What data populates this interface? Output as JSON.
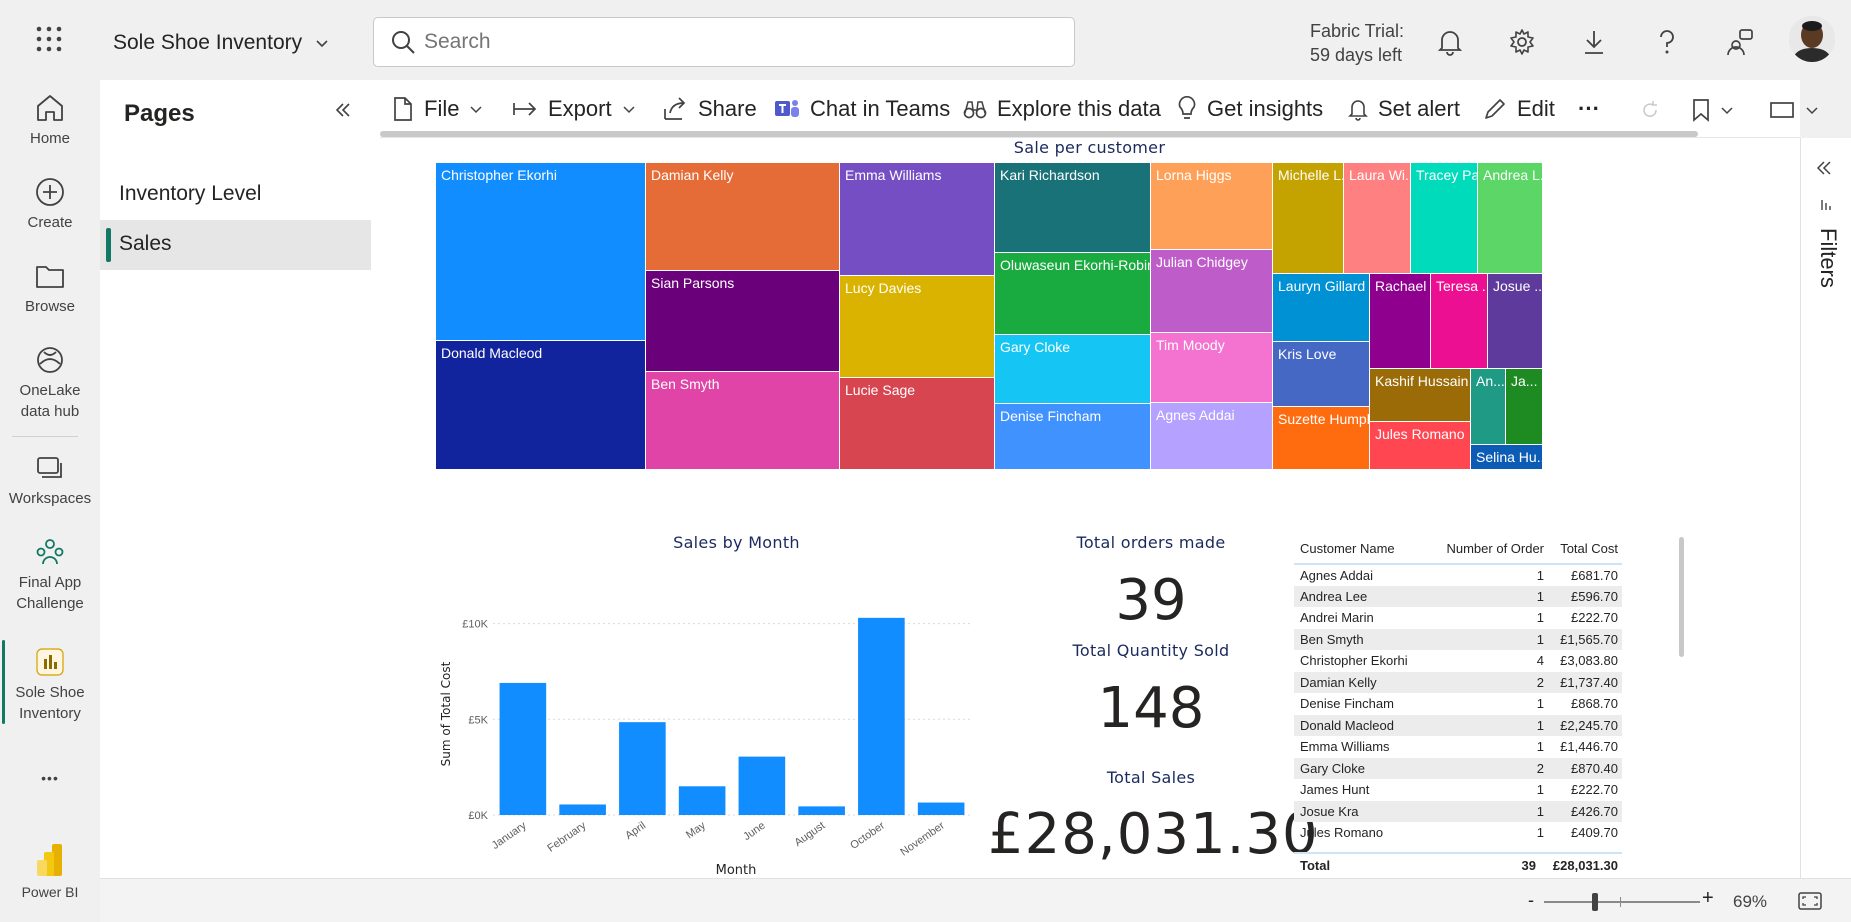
{
  "app": {
    "title": "Sole Shoe Inventory",
    "search_placeholder": "Search",
    "trial_line1": "Fabric Trial:",
    "trial_line2": "59 days left"
  },
  "nav": {
    "home": "Home",
    "create": "Create",
    "browse": "Browse",
    "onelake1": "OneLake",
    "onelake2": "data hub",
    "workspaces": "Workspaces",
    "final1": "Final App",
    "final2": "Challenge",
    "sole1": "Sole Shoe",
    "sole2": "Inventory",
    "more": "•••",
    "powerbi": "Power BI"
  },
  "pages": {
    "title": "Pages",
    "items": [
      "Inventory Level",
      "Sales"
    ],
    "selected": "Sales"
  },
  "toolbar": {
    "file": "File",
    "export": "Export",
    "share": "Share",
    "chat": "Chat in Teams",
    "explore": "Explore this data",
    "insights": "Get insights",
    "alert": "Set alert",
    "edit": "Edit",
    "more": "···"
  },
  "filters_label": "Filters",
  "treemap": {
    "title": "Sale per customer",
    "cells": [
      {
        "name": "Christopher Ekorhi",
        "color": "#118dff"
      },
      {
        "name": "Donald Macleod",
        "color": "#12239e"
      },
      {
        "name": "Damian Kelly",
        "color": "#e66c37"
      },
      {
        "name": "Sian Parsons",
        "color": "#6b007b"
      },
      {
        "name": "Ben Smyth",
        "color": "#e044a7"
      },
      {
        "name": "Emma Williams",
        "color": "#744ec2"
      },
      {
        "name": "Lucy Davies",
        "color": "#d9b300"
      },
      {
        "name": "Lucie Sage",
        "color": "#d64550"
      },
      {
        "name": "Kari Richardson",
        "color": "#197278"
      },
      {
        "name": "Oluwaseun Ekorhi-Robinson",
        "color": "#1aab40"
      },
      {
        "name": "Gary Cloke",
        "color": "#15c6f4"
      },
      {
        "name": "Denise Fincham",
        "color": "#4092ff"
      },
      {
        "name": "Lorna Higgs",
        "color": "#ffa058"
      },
      {
        "name": "Julian Chidgey",
        "color": "#be5dc9"
      },
      {
        "name": "Tim Moody",
        "color": "#f472d0"
      },
      {
        "name": "Agnes Addai",
        "color": "#b5a1ff"
      },
      {
        "name": "Michelle L...",
        "color": "#c4a200"
      },
      {
        "name": "Laura Wi...",
        "color": "#ff8080"
      },
      {
        "name": "Tracey Pa...",
        "color": "#00dbbc"
      },
      {
        "name": "Andrea L...",
        "color": "#5bd667"
      },
      {
        "name": "Lauryn Gillard",
        "color": "#0091d5"
      },
      {
        "name": "Rachael ...",
        "color": "#8f008f"
      },
      {
        "name": "Teresa ...",
        "color": "#ed0f91"
      },
      {
        "name": "Josue ...",
        "color": "#5d3a9b"
      },
      {
        "name": "Kris Love",
        "color": "#4668c5"
      },
      {
        "name": "Kashif Hussain",
        "color": "#9a6b07"
      },
      {
        "name": "An...",
        "color": "#1f9a85"
      },
      {
        "name": "Ja...",
        "color": "#1d8a22"
      },
      {
        "name": "Suzette Humph...",
        "color": "#ff6b0f"
      },
      {
        "name": "Jules Romano",
        "color": "#ff4651"
      },
      {
        "name": "Selina Hu...",
        "color": "#0c5cb5"
      }
    ]
  },
  "chart_data": {
    "type": "bar",
    "title": "Sales by Month",
    "xlabel": "Month",
    "ylabel": "Sum of Total Cost",
    "categories": [
      "January",
      "February",
      "April",
      "May",
      "June",
      "August",
      "October",
      "November"
    ],
    "values": [
      6900,
      550,
      4850,
      1500,
      3050,
      450,
      10300,
      650
    ],
    "yticks": [
      "£0K",
      "£5K",
      "£10K"
    ],
    "ylim": [
      0,
      10500
    ],
    "color": "#118dff",
    "grid": true
  },
  "kpis": {
    "orders_title": "Total orders made",
    "orders_value": "39",
    "qty_title": "Total Quantity Sold",
    "qty_value": "148",
    "sales_title": "Total Sales",
    "sales_value": "£28,031.30"
  },
  "table": {
    "headers": [
      "Customer Name",
      "Number of Order",
      "Total Cost"
    ],
    "rows": [
      [
        "Agnes Addai",
        "1",
        "£681.70"
      ],
      [
        "Andrea Lee",
        "1",
        "£596.70"
      ],
      [
        "Andrei Marin",
        "1",
        "£222.70"
      ],
      [
        "Ben Smyth",
        "1",
        "£1,565.70"
      ],
      [
        "Christopher Ekorhi",
        "4",
        "£3,083.80"
      ],
      [
        "Damian Kelly",
        "2",
        "£1,737.40"
      ],
      [
        "Denise Fincham",
        "1",
        "£868.70"
      ],
      [
        "Donald Macleod",
        "1",
        "£2,245.70"
      ],
      [
        "Emma Williams",
        "1",
        "£1,446.70"
      ],
      [
        "Gary Cloke",
        "2",
        "£870.40"
      ],
      [
        "James Hunt",
        "1",
        "£222.70"
      ],
      [
        "Josue Kra",
        "1",
        "£426.70"
      ],
      [
        "Jules Romano",
        "1",
        "£409.70"
      ]
    ],
    "total": [
      "Total",
      "39",
      "£28,031.30"
    ]
  },
  "status": {
    "minus": "-",
    "plus": "+",
    "zoom": "69%"
  }
}
